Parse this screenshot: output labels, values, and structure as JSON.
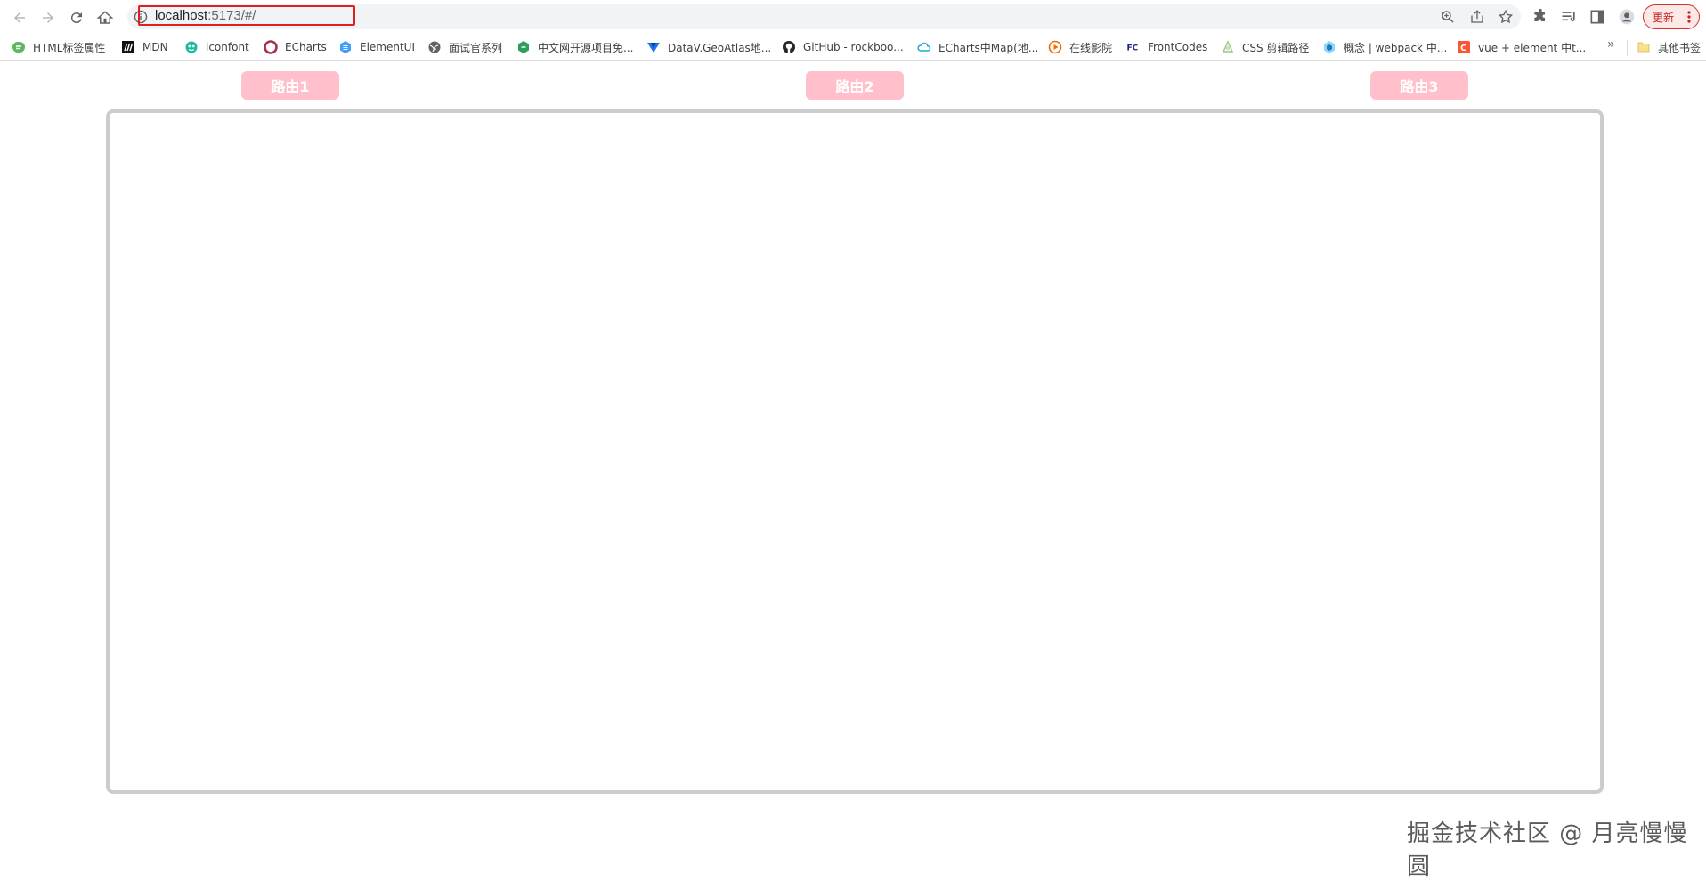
{
  "browser": {
    "url_host": "localhost",
    "url_rest": ":5173/#/",
    "update_label": "更新"
  },
  "bookmarks": [
    {
      "label": "HTML标签属性",
      "icon": "html-bookmark-icon"
    },
    {
      "label": "MDN",
      "icon": "mdn-icon"
    },
    {
      "label": "iconfont",
      "icon": "iconfont-icon"
    },
    {
      "label": "ECharts",
      "icon": "echarts-icon"
    },
    {
      "label": "ElementUI",
      "icon": "elementui-icon"
    },
    {
      "label": "面试官系列",
      "icon": "globe-icon"
    },
    {
      "label": "中文网开源项目免...",
      "icon": "opensource-icon"
    },
    {
      "label": "DataV.GeoAtlas地...",
      "icon": "datav-icon"
    },
    {
      "label": "GitHub - rockboo...",
      "icon": "github-icon"
    },
    {
      "label": "ECharts中Map(地...",
      "icon": "cloud-icon"
    },
    {
      "label": "在线影院",
      "icon": "play-icon"
    },
    {
      "label": "FrontCodes",
      "icon": "fc-icon"
    },
    {
      "label": "CSS 剪辑路径",
      "icon": "css-clip-icon"
    },
    {
      "label": "概念 | webpack 中...",
      "icon": "webpack-icon"
    },
    {
      "label": "vue + element 中t...",
      "icon": "csdn-icon"
    }
  ],
  "bookmarks_more": "»",
  "other_bookmarks": "其他书签",
  "routes": [
    {
      "label": "路由1"
    },
    {
      "label": "路由2"
    },
    {
      "label": "路由3"
    }
  ],
  "watermark": "掘金技术社区 @ 月亮慢慢圆",
  "colors": {
    "route_button": "#ffc0cb",
    "router_view_border": "#cccccc",
    "url_highlight": "#e02020"
  }
}
